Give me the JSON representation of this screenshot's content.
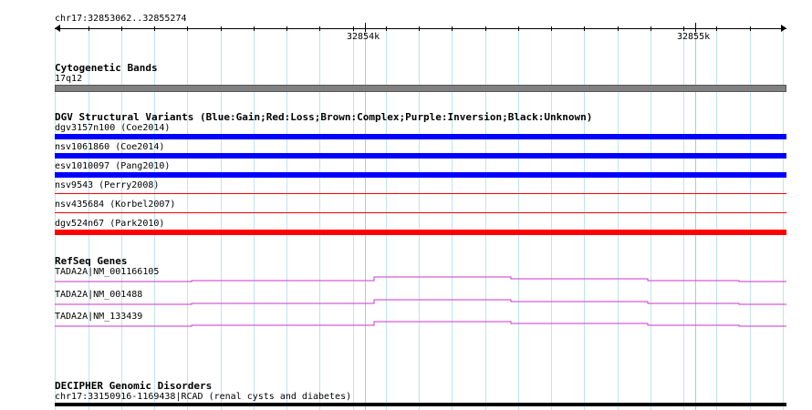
{
  "ruler": {
    "location": "chr17:32853062..32855274",
    "tick_labels": [
      "32854k",
      "32855k"
    ]
  },
  "cytobands": {
    "title": "Cytogenetic Bands",
    "band": "17q12"
  },
  "dgv": {
    "title": "DGV Structural Variants (Blue:Gain;Red:Loss;Brown:Complex;Purple:Inversion;Black:Unknown)",
    "variants": [
      {
        "label": "dgv3157n100 (Coe2014)",
        "type": "Gain",
        "color": "#0000ff"
      },
      {
        "label": "nsv1061860 (Coe2014)",
        "type": "Gain",
        "color": "#0000ff"
      },
      {
        "label": "esv1010097 (Pang2010)",
        "type": "Gain",
        "color": "#0000ff"
      },
      {
        "label": "nsv9543 (Perry2008)",
        "type": "Loss",
        "color": "#ff0000"
      },
      {
        "label": "nsv435684 (Korbel2007)",
        "type": "Loss",
        "color": "#ff0000"
      },
      {
        "label": "dgv524n67 (Park2010)",
        "type": "Loss",
        "color": "#ff0000"
      }
    ]
  },
  "refseq": {
    "title": "RefSeq Genes",
    "genes": [
      {
        "label": "TADA2A|NM_001166105",
        "color": "#cc33cc"
      },
      {
        "label": "TADA2A|NM_001488",
        "color": "#cc33cc"
      },
      {
        "label": "TADA2A|NM_133439",
        "color": "#cc33cc"
      }
    ]
  },
  "decipher": {
    "title": "DECIPHER Genomic Disorders",
    "entry": "chr17:33150916-1169438|RCAD (renal cysts and diabetes)"
  }
}
